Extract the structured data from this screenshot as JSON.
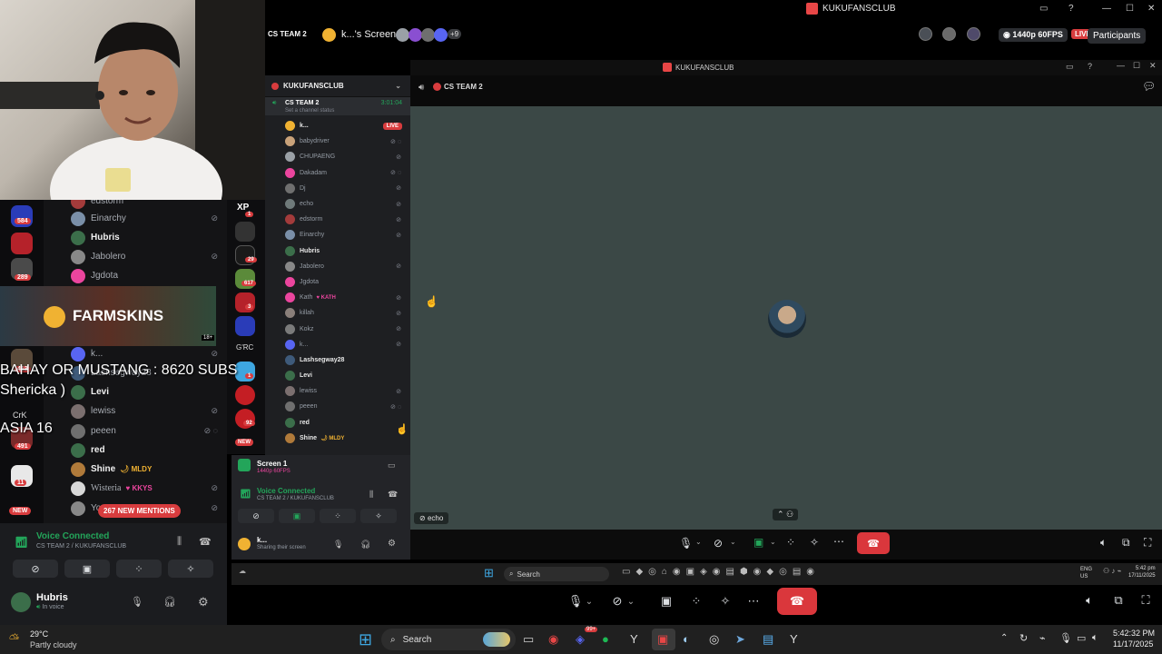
{
  "window": {
    "title": "KUKUFANSCLUB",
    "inner_title": "KUKUFANSCLUB"
  },
  "call_header": {
    "channel": "CS TEAM 2",
    "stream_label": "k...'s Screen",
    "extra_count": "+9",
    "quality": "1440p 60FPS",
    "live": "LIVE",
    "participants_label": "Participants"
  },
  "inner_header": {
    "channel": "CS TEAM 2"
  },
  "inner_sidebar": {
    "server_name": "KUKUFANSCLUB",
    "channel": "CS TEAM 2",
    "timer": "3:01:04",
    "status_hint": "Set a channel status",
    "live_badge": "LIVE",
    "members": [
      {
        "name": "k...",
        "avatar": "#f0b232",
        "bold": true,
        "icons": ""
      },
      {
        "name": "babydriver",
        "avatar": "#c9a27a",
        "icons": "⊘ ◌"
      },
      {
        "name": "CHUPAENG",
        "avatar": "#9aa0a6",
        "icons": "⊘"
      },
      {
        "name": "Dakadam",
        "avatar": "#eb459e",
        "icons": "⊘ ◌"
      },
      {
        "name": "Dj",
        "avatar": "#6f6f6f",
        "icons": "⊘"
      },
      {
        "name": "echo",
        "avatar": "#6f7a7a",
        "icons": "⊘"
      },
      {
        "name": "edstorm",
        "avatar": "#a33b3b",
        "icons": "⊘"
      },
      {
        "name": "Einarchy",
        "avatar": "#7a8fa8",
        "icons": "⊘"
      },
      {
        "name": "Hubris",
        "avatar": "#3b6e4a",
        "bold": true,
        "icons": ""
      },
      {
        "name": "Jabolero",
        "avatar": "#888",
        "icons": "⊘"
      },
      {
        "name": "Jgdota",
        "avatar": "#eb459e",
        "icons": ""
      },
      {
        "name": "Kath",
        "avatar": "#eb459e",
        "tag": "KATH",
        "icons": "⊘"
      },
      {
        "name": "killah",
        "avatar": "#8a7f7a",
        "icons": "⊘"
      },
      {
        "name": "Kokz",
        "avatar": "#7b7b7b",
        "icons": "⊘"
      },
      {
        "name": "k...",
        "avatar": "#5865f2",
        "icons": "⊘"
      },
      {
        "name": "Lashsegway28",
        "avatar": "#3e5a7a",
        "bold": true,
        "icons": ""
      },
      {
        "name": "Levi",
        "avatar": "#3b6e4a",
        "bold": true,
        "icons": ""
      },
      {
        "name": "lewiss",
        "avatar": "#7b6f6f",
        "icons": "⊘"
      },
      {
        "name": "peeen",
        "avatar": "#6f6f6f",
        "icons": "⊘ ◌"
      },
      {
        "name": "red",
        "avatar": "#3b6e4a",
        "bold": true,
        "icons": ""
      },
      {
        "name": "Shine",
        "avatar": "#b07a3a",
        "tag": "MLDY",
        "bold": true,
        "icons": ""
      }
    ]
  },
  "inner_bottom": {
    "screen_title": "Screen 1",
    "screen_sub": "1440p 60FPS",
    "voice_status": "Voice Connected",
    "voice_sub": "CS TEAM 2 / KUKUFANSCLUB",
    "user": "k...",
    "user_status": "Sharing their screen"
  },
  "stage": {
    "tile_label": "echo"
  },
  "overlay": {
    "banner": "FARMSKINS",
    "age": "18+",
    "line1": "BAHAY OR MUSTANG : 8620 SUBS",
    "line2": "Shericka )",
    "line3": "ASIA 16"
  },
  "left_list": {
    "members": [
      {
        "name": "edstorm",
        "avatar": "#a33b3b",
        "icons": ""
      },
      {
        "name": "Einarchy",
        "avatar": "#7a8fa8",
        "icons": "⊘"
      },
      {
        "name": "Hubris",
        "avatar": "#3b6e4a",
        "bold": true,
        "icons": ""
      },
      {
        "name": "Jabolero",
        "avatar": "#888",
        "icons": "⊘"
      },
      {
        "name": "Jgdota",
        "avatar": "#eb459e",
        "icons": ""
      },
      {
        "name": "k...",
        "avatar": "#5865f2",
        "icons": "⊘"
      },
      {
        "name": "Lashsegway28",
        "avatar": "#3e5a7a",
        "icons": ""
      },
      {
        "name": "Levi",
        "avatar": "#3b6e4a",
        "bold": true,
        "icons": ""
      },
      {
        "name": "lewiss",
        "avatar": "#7b6f6f",
        "icons": "⊘"
      },
      {
        "name": "peeen",
        "avatar": "#6f6f6f",
        "icons": "⊘ ◌"
      },
      {
        "name": "red",
        "avatar": "#3b6e4a",
        "bold": true,
        "icons": ""
      },
      {
        "name": "Shine",
        "avatar": "#b07a3a",
        "tag": "MLDY",
        "bold": true,
        "icons": ""
      },
      {
        "name": "Wisteria",
        "avatar": "#d8d8d8",
        "tag": "KKYS",
        "icons": "⊘"
      },
      {
        "name": "Yo",
        "avatar": "#888",
        "icons": "⊘"
      }
    ],
    "new_mentions": "267 NEW MENTIONS"
  },
  "servers": {
    "badges": [
      "584",
      "289",
      "413",
      "491",
      "11"
    ],
    "new_label": "NEW",
    "crk": "CrK"
  },
  "mid_servers": {
    "xp": "XP",
    "grc": "G'RC",
    "badges": [
      "1",
      "29",
      "617",
      "3",
      "1",
      "92"
    ],
    "new_label": "NEW"
  },
  "left_voice": {
    "status": "Voice Connected",
    "sub": "CS TEAM 2 / KUKUFANSCLUB",
    "user": "Hubris",
    "user_status": "In voice"
  },
  "inner_taskbar": {
    "search": "Search",
    "lang1": "ENG",
    "lang2": "US",
    "time": "5:42 pm",
    "date": "17/11/2025"
  },
  "taskbar": {
    "weather_temp": "29°C",
    "weather_desc": "Partly cloudy",
    "search": "Search",
    "badge": "99+",
    "time": "5:42:32 PM",
    "date": "11/17/2025"
  },
  "colors": {
    "accent": "#5865f2",
    "danger": "#da373c",
    "live": "#d83c3e",
    "voice_green": "#23a55a",
    "stage_bg": "#3b4846"
  }
}
